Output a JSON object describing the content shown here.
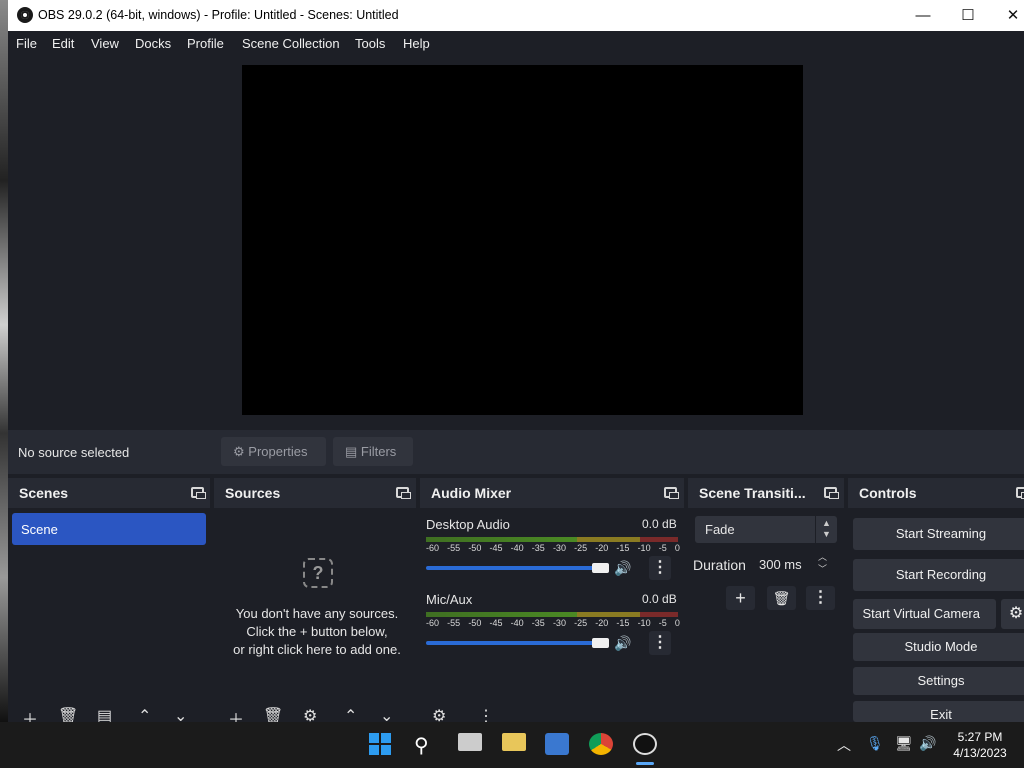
{
  "window": {
    "title": "OBS 29.0.2 (64-bit, windows) - Profile: Untitled - Scenes: Untitled"
  },
  "menu": [
    "File",
    "Edit",
    "View",
    "Docks",
    "Profile",
    "Scene Collection",
    "Tools",
    "Help"
  ],
  "source_bar": {
    "status": "No source selected",
    "properties": "Properties",
    "filters": "Filters"
  },
  "scenes": {
    "title": "Scenes",
    "items": [
      "Scene"
    ]
  },
  "sources": {
    "title": "Sources",
    "empty_line1": "You don't have any sources.",
    "empty_line2": "Click the + button below,",
    "empty_line3": "or right click here to add one."
  },
  "audio_mixer": {
    "title": "Audio Mixer",
    "channels": [
      {
        "name": "Desktop Audio",
        "db": "0.0 dB",
        "volume": 1.0
      },
      {
        "name": "Mic/Aux",
        "db": "0.0 dB",
        "volume": 1.0
      }
    ],
    "scale": [
      "-60",
      "-55",
      "-50",
      "-45",
      "-40",
      "-35",
      "-30",
      "-25",
      "-20",
      "-15",
      "-10",
      "-5",
      "0"
    ]
  },
  "transitions": {
    "title": "Scene Transiti...",
    "selected": "Fade",
    "duration_label": "Duration",
    "duration_value": "300 ms"
  },
  "controls": {
    "title": "Controls",
    "start_streaming": "Start Streaming",
    "start_recording": "Start Recording",
    "start_virtual_camera": "Start Virtual Camera",
    "studio_mode": "Studio Mode",
    "settings": "Settings",
    "exit": "Exit"
  },
  "taskbar": {
    "time": "5:27 PM",
    "date": "4/13/2023"
  },
  "colors": {
    "accent": "#2b56c2",
    "bg": "#1d1f26",
    "panel": "#272a33"
  }
}
